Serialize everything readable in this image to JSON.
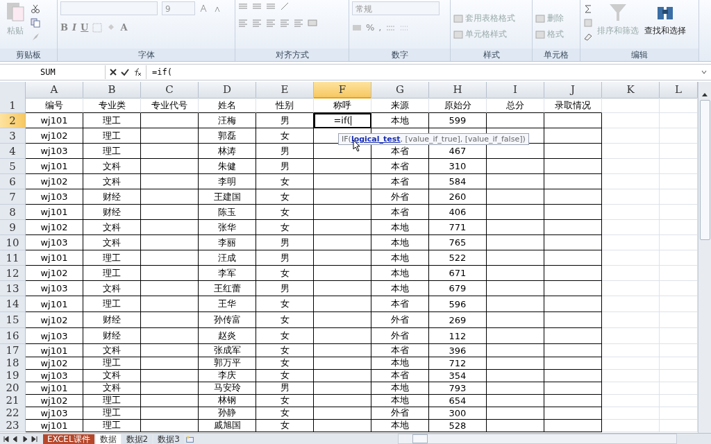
{
  "ribbon": {
    "groups": [
      {
        "kind": "clipboard",
        "label": "剪贴板",
        "paste": {
          "label": "粘贴",
          "disabled": true
        }
      },
      {
        "kind": "font",
        "label": "字体",
        "font_size": "9",
        "buttons": [
          "B",
          "I",
          "U"
        ],
        "color_letter": "A"
      },
      {
        "kind": "align",
        "label": "对齐方式"
      },
      {
        "kind": "number",
        "label": "数字",
        "format": "常规",
        "percent": "%",
        "comma": ","
      },
      {
        "kind": "styles",
        "label": "样式",
        "items": [
          {
            "label": "套用表格格式",
            "disabled": true
          },
          {
            "label": "单元格样式",
            "disabled": true
          }
        ]
      },
      {
        "kind": "cells",
        "label": "单元格",
        "items": [
          {
            "label": "删除",
            "disabled": true
          },
          {
            "label": "格式",
            "disabled": true
          }
        ]
      },
      {
        "kind": "editing",
        "label": "编辑",
        "items": [
          {
            "label": "排序和筛选",
            "disabled": true
          },
          {
            "label": "查找和选择",
            "disabled": false
          }
        ]
      }
    ]
  },
  "formula_bar": {
    "name_box": "SUM",
    "formula": "=if("
  },
  "columns": [
    {
      "letter": "A",
      "selected": false
    },
    {
      "letter": "B",
      "selected": false
    },
    {
      "letter": "C",
      "selected": false
    },
    {
      "letter": "D",
      "selected": false
    },
    {
      "letter": "E",
      "selected": false
    },
    {
      "letter": "F",
      "selected": true
    },
    {
      "letter": "G",
      "selected": false
    },
    {
      "letter": "H",
      "selected": false
    },
    {
      "letter": "I",
      "selected": false
    },
    {
      "letter": "J",
      "selected": false
    },
    {
      "letter": "K",
      "selected": false
    },
    {
      "letter": "L",
      "selected": false
    }
  ],
  "rows": [
    {
      "num": "1",
      "kind": "header",
      "selected": false,
      "cells": {
        "A": "编号",
        "B": "专业类",
        "C": "专业代号",
        "D": "姓名",
        "E": "性别",
        "F": "称呼",
        "G": "来源",
        "H": "原始分",
        "I": "总分",
        "J": "录取情况"
      }
    },
    {
      "num": "2",
      "kind": "data",
      "selected": true,
      "cells": {
        "A": "wj101",
        "B": "理工",
        "D": "汪梅",
        "E": "男",
        "F": "=if(",
        "G": "本地",
        "H": "599"
      }
    },
    {
      "num": "3",
      "kind": "data",
      "selected": false,
      "cells": {
        "A": "wj102",
        "B": "理工",
        "D": "郭磊",
        "E": "女"
      }
    },
    {
      "num": "4",
      "kind": "data",
      "selected": false,
      "cells": {
        "A": "wj103",
        "B": "理工",
        "D": "林涛",
        "E": "男",
        "G": "本省",
        "H": "467"
      }
    },
    {
      "num": "5",
      "kind": "data",
      "selected": false,
      "cells": {
        "A": "wj101",
        "B": "文科",
        "D": "朱健",
        "E": "男",
        "G": "本省",
        "H": "310"
      }
    },
    {
      "num": "6",
      "kind": "data",
      "selected": false,
      "cells": {
        "A": "wj102",
        "B": "文科",
        "D": "李明",
        "E": "女",
        "G": "本省",
        "H": "584"
      }
    },
    {
      "num": "7",
      "kind": "data",
      "selected": false,
      "cells": {
        "A": "wj103",
        "B": "财经",
        "D": "王建国",
        "E": "女",
        "G": "外省",
        "H": "260"
      }
    },
    {
      "num": "8",
      "kind": "data",
      "selected": false,
      "cells": {
        "A": "wj101",
        "B": "财经",
        "D": "陈玉",
        "E": "女",
        "G": "本省",
        "H": "406"
      }
    },
    {
      "num": "9",
      "kind": "data",
      "selected": false,
      "cells": {
        "A": "wj102",
        "B": "文科",
        "D": "张华",
        "E": "女",
        "G": "本地",
        "H": "771"
      }
    },
    {
      "num": "10",
      "kind": "data",
      "selected": false,
      "cells": {
        "A": "wj103",
        "B": "文科",
        "D": "李丽",
        "E": "男",
        "G": "本地",
        "H": "765"
      }
    },
    {
      "num": "11",
      "kind": "data",
      "selected": false,
      "cells": {
        "A": "wj101",
        "B": "理工",
        "D": "汪成",
        "E": "男",
        "G": "本地",
        "H": "522"
      }
    },
    {
      "num": "12",
      "kind": "data",
      "selected": false,
      "cells": {
        "A": "wj102",
        "B": "理工",
        "D": "李军",
        "E": "女",
        "G": "本地",
        "H": "671"
      }
    },
    {
      "num": "13",
      "kind": "data",
      "selected": false,
      "cells": {
        "A": "wj103",
        "B": "文科",
        "D": "王红蕾",
        "E": "男",
        "G": "本地",
        "H": "679"
      }
    },
    {
      "num": "14",
      "kind": "data",
      "selected": false,
      "cells": {
        "A": "wj101",
        "B": "理工",
        "D": "王华",
        "E": "女",
        "G": "本省",
        "H": "596"
      }
    },
    {
      "num": "15",
      "kind": "data",
      "selected": false,
      "cells": {
        "A": "wj102",
        "B": "财经",
        "D": "孙传富",
        "E": "女",
        "G": "外省",
        "H": "269"
      }
    },
    {
      "num": "16",
      "kind": "data",
      "selected": false,
      "cells": {
        "A": "wj103",
        "B": "财经",
        "D": "赵炎",
        "E": "女",
        "G": "外省",
        "H": "112"
      }
    },
    {
      "num": "17",
      "kind": "data",
      "selected": false,
      "cells": {
        "A": "wj101",
        "B": "文科",
        "D": "张成军",
        "E": "女",
        "G": "本省",
        "H": "396"
      }
    },
    {
      "num": "18",
      "kind": "data",
      "selected": false,
      "cells": {
        "A": "wj102",
        "B": "理工",
        "D": "郭万平",
        "E": "女",
        "G": "本地",
        "H": "712"
      }
    },
    {
      "num": "19",
      "kind": "data",
      "selected": false,
      "cells": {
        "A": "wj103",
        "B": "文科",
        "D": "李庆",
        "E": "女",
        "G": "本省",
        "H": "354"
      }
    },
    {
      "num": "20",
      "kind": "data",
      "selected": false,
      "cells": {
        "A": "wj101",
        "B": "文科",
        "D": "马安玲",
        "E": "男",
        "G": "本地",
        "H": "793"
      }
    },
    {
      "num": "21",
      "kind": "data",
      "selected": false,
      "cells": {
        "A": "wj102",
        "B": "理工",
        "D": "林钢",
        "E": "女",
        "G": "本地",
        "H": "654"
      }
    },
    {
      "num": "22",
      "kind": "data",
      "selected": false,
      "cells": {
        "A": "wj103",
        "B": "理工",
        "D": "孙静",
        "E": "女",
        "G": "外省",
        "H": "300"
      }
    },
    {
      "num": "23",
      "kind": "data",
      "selected": false,
      "cells": {
        "A": "wj101",
        "B": "理工",
        "D": "戚旭国",
        "E": "女",
        "G": "本地",
        "H": "528"
      }
    }
  ],
  "tooltip": {
    "function": "IF(",
    "current_arg": "logical_test",
    "rest": ", [value_if_true], [value_if_false])"
  },
  "sheet_tabs": [
    {
      "label": "EXCEL课件",
      "selected": false,
      "color": "#b5472b"
    },
    {
      "label": "数据",
      "selected": true
    },
    {
      "label": "数据2",
      "selected": false
    },
    {
      "label": "数据3",
      "selected": false
    }
  ]
}
